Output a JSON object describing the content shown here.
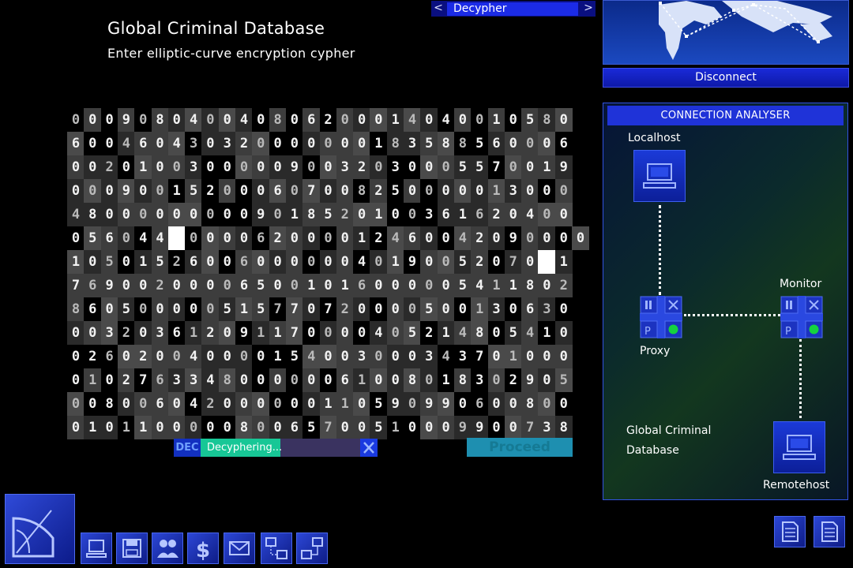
{
  "header": {
    "title": "Global Criminal Database",
    "subtitle": "Enter elliptic-curve encryption cypher"
  },
  "tab_selector": {
    "prev": "<",
    "label": "Decypher",
    "next": ">"
  },
  "disconnect_label": "Disconnect",
  "cipher_rows": [
    "000908040040806200014040010580",
    "600460430320000000183588560006",
    "002010030000090032030005570019",
    "000900152000607008250000013000",
    "480000000009018520100361620400",
    "056044 000062000012460042090000",
    "1050152600600000040190052070 1",
    "769002000065001016000005411802",
    "860500000515770720000500130630",
    "003203612091170000405214805410",
    "026020040000154003000343701000",
    "010276334800000061008018302905",
    "008006042000000110590990600800",
    "010110000080065700510009900738"
  ],
  "status": {
    "badge": "DEC",
    "progress_text": "Decyphering...",
    "progress": 0.5,
    "cancel_icon": "close-icon",
    "proceed_label": "Proceed"
  },
  "analyser": {
    "title": "CONNECTION ANALYSER",
    "localhost": "Localhost",
    "proxy": "Proxy",
    "monitor": "Monitor",
    "target": "Global Criminal",
    "target2": "Database",
    "remotehost": "Remotehost"
  },
  "taskbar": {
    "icons": [
      "computer-icon",
      "floppy-disk-icon",
      "people-icon",
      "dollar-icon",
      "mail-icon",
      "network-icon",
      "connection-icon"
    ],
    "dollar_glyph": "$"
  },
  "colors": {
    "accent": "#1b2be6",
    "progress": "#17c796",
    "proceed": "#1e8fb0",
    "background": "#000000"
  }
}
